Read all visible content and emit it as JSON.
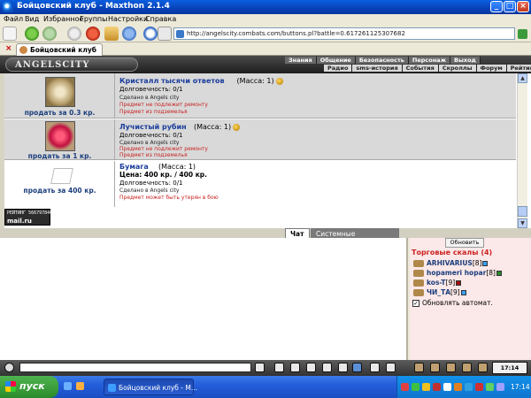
{
  "window": {
    "title": "Бойцовский клуб - Maxthon 2.1.4",
    "controls": {
      "min": "_",
      "max": "□",
      "close": "×"
    }
  },
  "menu": [
    "Файл",
    "Вид",
    "Избранное",
    "Группы",
    "Настройки",
    "Справка"
  ],
  "address": {
    "url": "http://angelscity.combats.com/buttons.pl?battle=0.617261125307682"
  },
  "tab": {
    "label": "Бойцовский клуб"
  },
  "game": {
    "logo": "ANGELSCITY",
    "nav_top": [
      "Знания",
      "Общение",
      "Безопасность",
      "Персонаж",
      "Выход"
    ],
    "nav_bottom": [
      "Радио",
      "sms-история",
      "События",
      "Скроллы",
      "Форум",
      "Рейтинг"
    ]
  },
  "items": [
    {
      "name": "Кристалл тысячи ответов",
      "mass": "(Масса: 1)",
      "sell": "продать за 0.3 кр.",
      "lines": [
        "Долговечность: 0/1"
      ],
      "made": "Сделано в Angels city",
      "notes": [
        "Предмет не подлежит ремонту",
        "Предмет из подземелья"
      ]
    },
    {
      "name": "Лучистый рубин",
      "mass": "(Масса: 1)",
      "sell": "продать за 1 кр.",
      "lines": [
        "Долговечность: 0/1"
      ],
      "made": "Сделано в Angels city",
      "notes": [
        "Предмет не подлежит ремонту",
        "Предмет из подземелья"
      ]
    },
    {
      "name": "Бумага",
      "mass": "(Масса: 1)",
      "sell": "продать за 400 кр.",
      "price": "Цена: 400 кр. / 400 кр.",
      "lines": [
        "Долговечность: 0/1"
      ],
      "made": "Сделано в Angels city",
      "notes": [
        "Предмет может быть утерян в бою"
      ]
    }
  ],
  "counter": {
    "line1": "РЕЙТИНГ 566797846",
    "line2": "mail.ru"
  },
  "chat_tabs": {
    "active": "Чат",
    "other": "Системные сообщения"
  },
  "side": {
    "refresh": "Обновить",
    "heading": "Торговые скалы (4)",
    "players": [
      {
        "name": "ARHIVARIUS",
        "level": "[8]"
      },
      {
        "name": "hopameri hopar",
        "level": "[8]"
      },
      {
        "name": "kos-T",
        "level": "[9]"
      },
      {
        "name": "ЧИ_ТА",
        "level": "[9]"
      }
    ],
    "auto_refresh": "Обновлять автомат."
  },
  "input_bar": {
    "clock": "17:14"
  },
  "taskbar": {
    "start": "пуск",
    "task": "Бойцовский клуб - М...",
    "time": "17:14"
  },
  "colors": {
    "accent": "#1b3d9c",
    "warning": "#c81e1e",
    "panel": "#fbe8e8"
  }
}
